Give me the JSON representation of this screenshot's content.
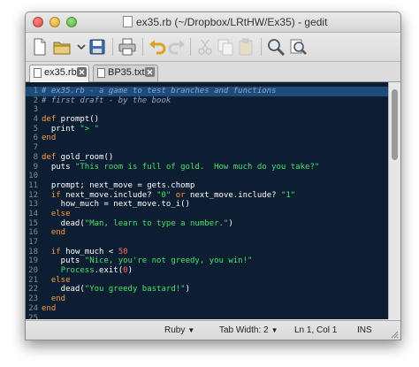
{
  "window": {
    "title": "ex35.rb (~/Dropbox/LRtHW/Ex35) - gedit"
  },
  "toolbar": {
    "buttons": [
      "new-document-icon",
      "open-folder-icon",
      "dropdown-arrow-icon",
      "save-icon",
      "print-icon",
      "undo-icon",
      "redo-icon",
      "cut-icon",
      "copy-icon",
      "paste-icon",
      "find-icon",
      "find-replace-icon"
    ]
  },
  "tabs": [
    {
      "label": "ex35.rb",
      "active": true
    },
    {
      "label": "BP35.txt",
      "active": false
    }
  ],
  "editor": {
    "theme_background": "#0d1e33",
    "current_line": 1,
    "lines": [
      {
        "num": "1",
        "segs": [
          {
            "t": "# ex35.rb - a game to test branches and functions",
            "c": "c"
          }
        ]
      },
      {
        "num": "2",
        "segs": [
          {
            "t": "# first draft - by the book",
            "c": "c"
          }
        ]
      },
      {
        "num": "3",
        "segs": []
      },
      {
        "num": "4",
        "segs": [
          {
            "t": "def",
            "c": "k"
          },
          {
            "t": " prompt()"
          }
        ]
      },
      {
        "num": "5",
        "segs": [
          {
            "t": "  print "
          },
          {
            "t": "\"> \"",
            "c": "s"
          }
        ]
      },
      {
        "num": "6",
        "segs": [
          {
            "t": "end",
            "c": "k"
          }
        ]
      },
      {
        "num": "7",
        "segs": []
      },
      {
        "num": "8",
        "segs": [
          {
            "t": "def",
            "c": "k"
          },
          {
            "t": " gold_room()"
          }
        ]
      },
      {
        "num": "9",
        "segs": [
          {
            "t": "  puts "
          },
          {
            "t": "\"This room is full of gold.  How much do you take?\"",
            "c": "s"
          }
        ]
      },
      {
        "num": "10",
        "segs": []
      },
      {
        "num": "11",
        "segs": [
          {
            "t": "  prompt; next_move = gets.chomp"
          }
        ]
      },
      {
        "num": "12",
        "segs": [
          {
            "t": "  "
          },
          {
            "t": "if",
            "c": "k"
          },
          {
            "t": " next_move.include? "
          },
          {
            "t": "\"0\"",
            "c": "s"
          },
          {
            "t": " "
          },
          {
            "t": "or",
            "c": "k"
          },
          {
            "t": " next_move.include? "
          },
          {
            "t": "\"1\"",
            "c": "s"
          }
        ]
      },
      {
        "num": "13",
        "segs": [
          {
            "t": "    how_much = next_move.to_i()"
          }
        ]
      },
      {
        "num": "14",
        "segs": [
          {
            "t": "  "
          },
          {
            "t": "else",
            "c": "k"
          }
        ]
      },
      {
        "num": "15",
        "segs": [
          {
            "t": "    dead("
          },
          {
            "t": "\"Man, learn to type a number.\"",
            "c": "s"
          },
          {
            "t": ")"
          }
        ]
      },
      {
        "num": "16",
        "segs": [
          {
            "t": "  "
          },
          {
            "t": "end",
            "c": "k"
          }
        ]
      },
      {
        "num": "17",
        "segs": []
      },
      {
        "num": "18",
        "segs": [
          {
            "t": "  "
          },
          {
            "t": "if",
            "c": "k"
          },
          {
            "t": " how_much < "
          },
          {
            "t": "50",
            "c": "n"
          }
        ]
      },
      {
        "num": "19",
        "segs": [
          {
            "t": "    puts "
          },
          {
            "t": "\"Nice, you're not greedy, you win!\"",
            "c": "s"
          }
        ]
      },
      {
        "num": "20",
        "segs": [
          {
            "t": "    "
          },
          {
            "t": "Process",
            "c": "s"
          },
          {
            "t": ".exit("
          },
          {
            "t": "0",
            "c": "n"
          },
          {
            "t": ")"
          }
        ]
      },
      {
        "num": "21",
        "segs": [
          {
            "t": "  "
          },
          {
            "t": "else",
            "c": "k"
          }
        ]
      },
      {
        "num": "22",
        "segs": [
          {
            "t": "    dead("
          },
          {
            "t": "\"You greedy bastard!\"",
            "c": "s"
          },
          {
            "t": ")"
          }
        ]
      },
      {
        "num": "23",
        "segs": [
          {
            "t": "  "
          },
          {
            "t": "end",
            "c": "k"
          }
        ]
      },
      {
        "num": "24",
        "segs": [
          {
            "t": "end",
            "c": "k"
          }
        ]
      },
      {
        "num": "25",
        "segs": []
      },
      {
        "num": "26",
        "segs": []
      }
    ]
  },
  "statusbar": {
    "language": "Ruby",
    "tab_width": "Tab Width: 2",
    "position": "Ln 1, Col 1",
    "mode": "INS"
  }
}
